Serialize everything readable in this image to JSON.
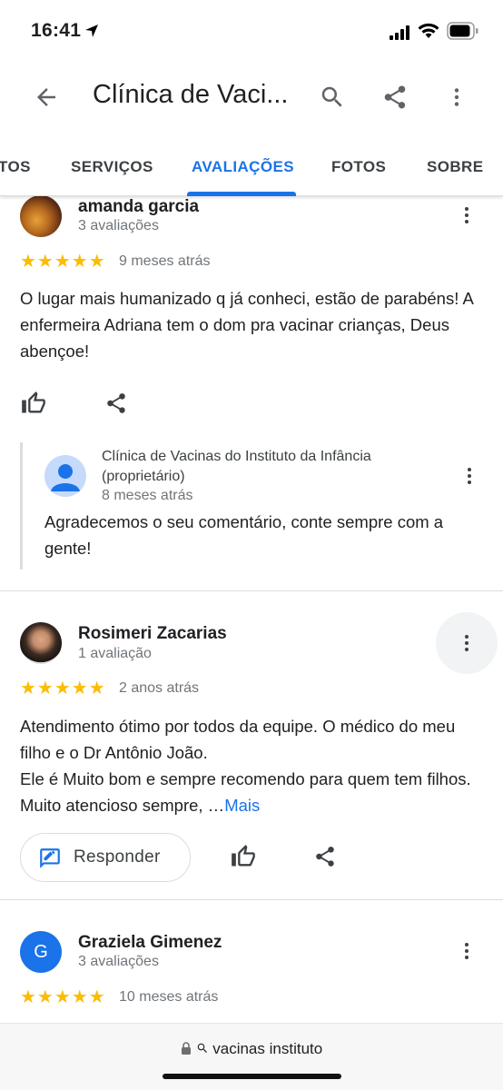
{
  "status_bar": {
    "time": "16:41"
  },
  "app_bar": {
    "title": "Clínica de Vaci..."
  },
  "tabs": [
    {
      "label": "TOS"
    },
    {
      "label": "SERVIÇOS"
    },
    {
      "label": "AVALIAÇÕES",
      "active": true
    },
    {
      "label": "FOTOS"
    },
    {
      "label": "SOBRE"
    }
  ],
  "reviews": [
    {
      "name": "amanda garcia",
      "count": "3 avaliações",
      "stars": "★★★★★",
      "rating": 5,
      "when": "9 meses atrás",
      "text": "O lugar mais humanizado q já conheci, estão de parabéns! A enfermeira Adriana tem o dom pra vacinar crianças, Deus abençoe!",
      "owner_reply": {
        "name": "Clínica de Vacinas do Instituto da Infância (proprietário)",
        "when": "8 meses atrás",
        "text": "Agradecemos o seu comentário, conte sempre com a gente!"
      }
    },
    {
      "name": "Rosimeri Zacarias",
      "count": "1 avaliação",
      "stars": "★★★★★",
      "rating": 5,
      "when": "2 anos atrás",
      "text": "Atendimento ótimo por todos da equipe. O médico do meu filho e o Dr Antônio João.\nEle é Muito bom e sempre recomendo para quem tem filhos. Muito atencioso sempre, …",
      "more_label": "Mais",
      "respond_label": "Responder"
    },
    {
      "name": "Graziela Gimenez",
      "initial": "G",
      "count": "3 avaliações",
      "stars": "★★★★★",
      "rating": 5,
      "when": "10 meses atrás"
    }
  ],
  "browser": {
    "url": "vacinas instituto"
  },
  "colors": {
    "accent": "#1a73e8",
    "star": "#fbbc04",
    "text": "#202124",
    "secondary": "#70757a"
  }
}
